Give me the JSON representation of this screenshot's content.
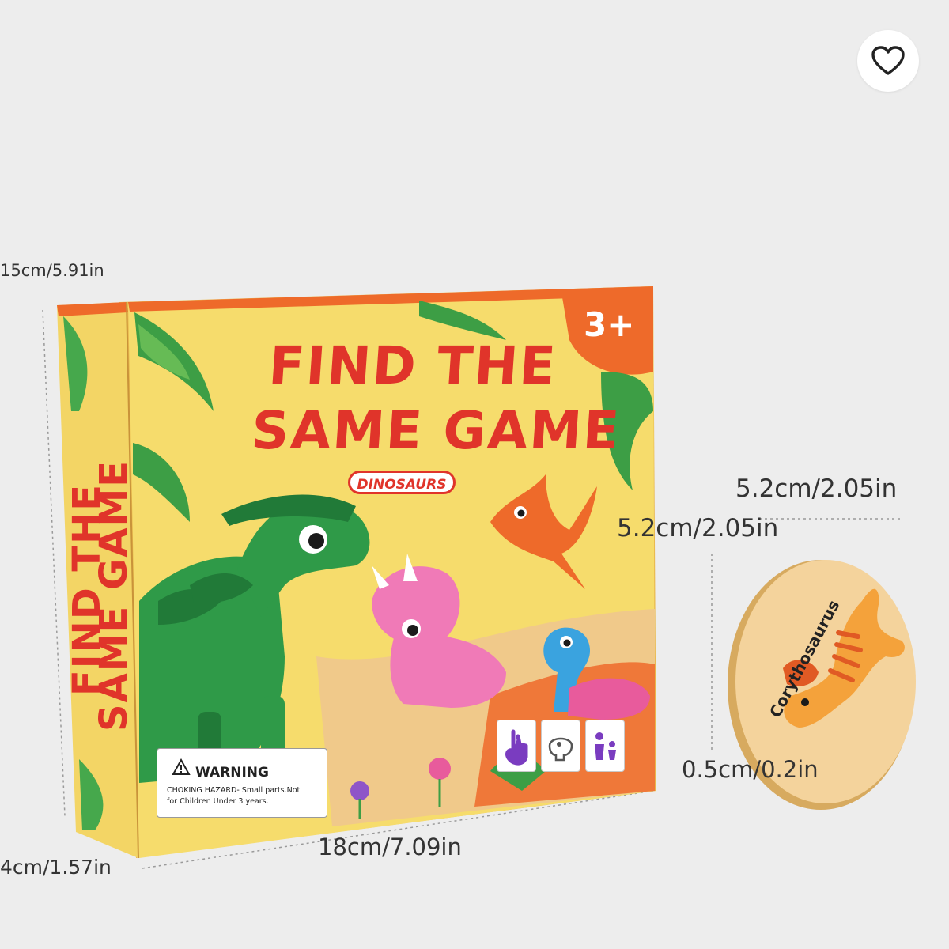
{
  "favorite": {
    "icon": "heart-outline-icon"
  },
  "product": {
    "title_line1": "FIND THE",
    "title_line2": "SAME GAME",
    "spine_line1": "FIND THE",
    "spine_line2": "SAME GAME",
    "category": "DINOSAURS",
    "age": "3+",
    "warning_title": "WARNING",
    "warning_text": "CHOKING HAZARD- Small parts.Not\nfor Children Under  3 years.",
    "chip_name": "Corythosaurus"
  },
  "dimensions": {
    "box_height": "15cm/5.91in",
    "box_depth": "4cm/1.57in",
    "box_width": "18cm/7.09in",
    "chip_width": "5.2cm/2.05in",
    "chip_height": "5.2cm/2.05in",
    "chip_thickness": "0.5cm/0.2in"
  },
  "colors": {
    "background": "#ededed",
    "box_yellow": "#f6dc6c",
    "title_red": "#e0342a",
    "accent_orange": "#ee6a2a"
  }
}
